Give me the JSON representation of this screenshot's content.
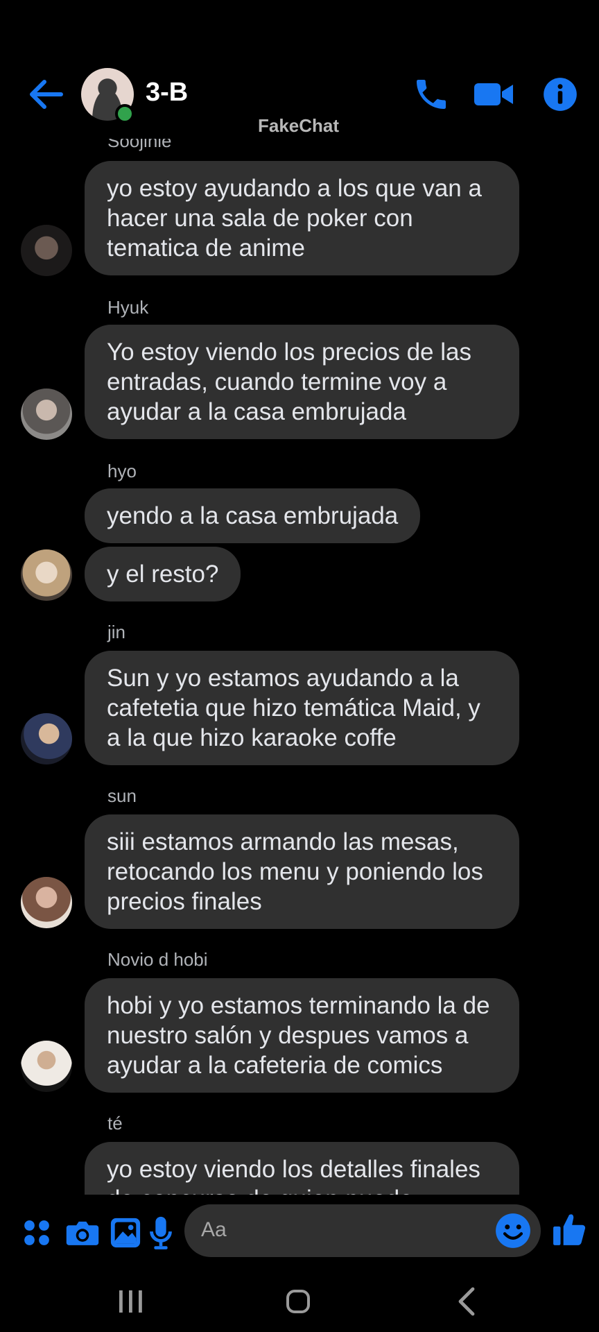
{
  "header": {
    "title": "3-B",
    "watermark": "FakeChat",
    "icons": [
      "back-arrow-icon",
      "phone-icon",
      "video-camera-icon",
      "info-icon"
    ],
    "accent_color": "#1877f2",
    "online_color": "#31a24c"
  },
  "messages": [
    {
      "sender": "Soojinie",
      "bubbles": [
        "yo estoy ayudando a los que van a hacer una sala de poker con tematica de anime"
      ]
    },
    {
      "sender": "Hyuk",
      "bubbles": [
        "Yo estoy viendo los precios de las entradas, cuando termine voy a ayudar a la casa embrujada"
      ]
    },
    {
      "sender": "hyo",
      "bubbles": [
        "yendo a la casa embrujada",
        "y el resto?"
      ]
    },
    {
      "sender": "jin",
      "bubbles": [
        "Sun y yo estamos ayudando a la cafetetia que hizo temática Maid, y a la que hizo karaoke coffe"
      ]
    },
    {
      "sender": "sun",
      "bubbles": [
        "siii estamos armando las mesas, retocando los menu y poniendo los precios finales"
      ]
    },
    {
      "sender": "Novio d hobi",
      "bubbles": [
        "hobi y yo estamos terminando la de nuestro salón y despues vamos a ayudar a la cafeteria de comics"
      ]
    },
    {
      "sender": "té",
      "bubbles": [
        "yo estoy viendo los detalles finales de concurso de quien puede"
      ]
    }
  ],
  "composer": {
    "placeholder": "Aa",
    "icons": [
      "apps-grid-icon",
      "camera-icon",
      "gallery-icon",
      "microphone-icon",
      "emoji-icon",
      "thumbs-up-icon"
    ]
  },
  "navbar": {
    "icons": [
      "recent-apps-icon",
      "home-icon",
      "back-icon"
    ]
  },
  "colors": {
    "background": "#000000",
    "bubble": "#303030",
    "sender_name": "#b0b3b8",
    "text": "#e4e6eb"
  }
}
